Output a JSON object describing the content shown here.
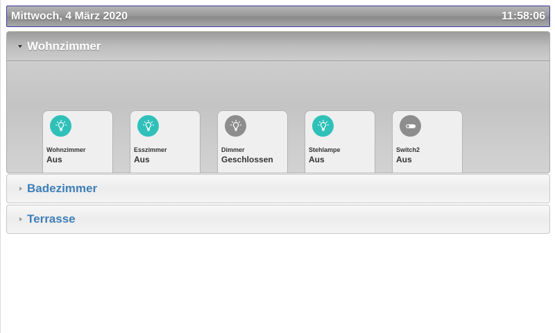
{
  "header": {
    "date": "Mittwoch, 4 März 2020",
    "time": "11:58:06"
  },
  "colors": {
    "active_icon": "#2fc1b9",
    "inactive_icon": "#8d8d8d",
    "section_link": "#3d7fb8"
  },
  "rooms": [
    {
      "title": "Wohnzimmer",
      "expanded": true,
      "devices": [
        {
          "name": "Wohnzimmer",
          "state": "Aus",
          "icon": "bulb-icon",
          "active": true
        },
        {
          "name": "Esszimmer",
          "state": "Aus",
          "icon": "bulb-icon",
          "active": true
        },
        {
          "name": "Dimmer",
          "state": "Geschlossen",
          "icon": "bulb-icon",
          "active": false
        },
        {
          "name": "Stehlampe",
          "state": "Aus",
          "icon": "bulb-icon",
          "active": true
        },
        {
          "name": "Switch2",
          "state": "Aus",
          "icon": "switch-icon",
          "active": false
        }
      ]
    },
    {
      "title": "Badezimmer",
      "expanded": false
    },
    {
      "title": "Terrasse",
      "expanded": false
    }
  ]
}
